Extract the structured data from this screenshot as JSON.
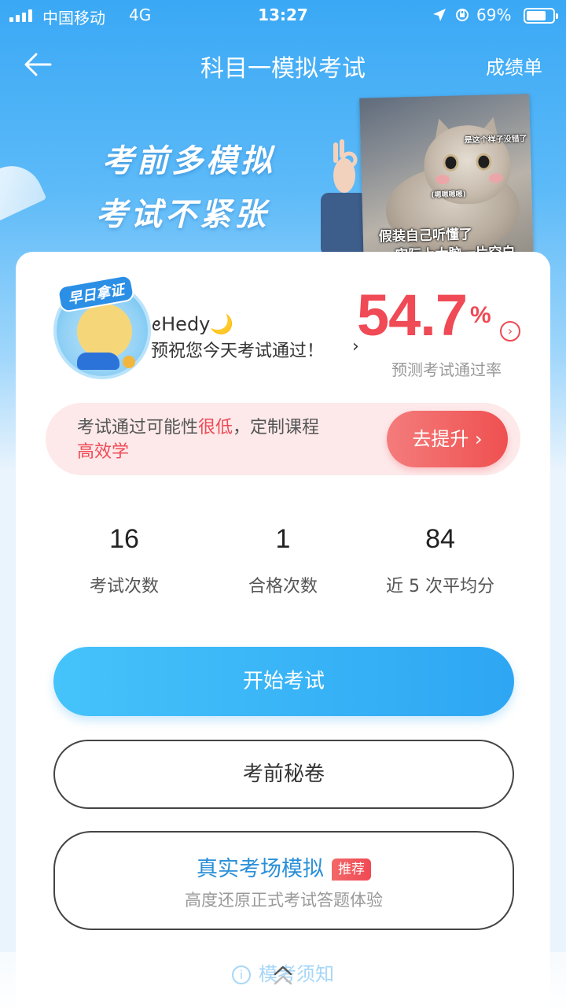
{
  "status_bar": {
    "carrier": "中国移动",
    "network": "4G",
    "time": "13:27",
    "battery_percent": "69%"
  },
  "nav": {
    "title": "科目一模拟考试",
    "right_link": "成绩单"
  },
  "banner": {
    "slogan_line1": "考前多模拟",
    "slogan_line2": "考试不紧张",
    "meme_small1": "是这个样子没错了",
    "meme_small2": "(嗯嗯嗯嗯)",
    "meme_line1": "假装自己听懂了",
    "meme_line2": "实际上大脑一片空白"
  },
  "profile": {
    "avatar_tag": "早日拿证",
    "username": "ꫀHedy",
    "username_emoji": "🌙",
    "wish": "预祝您今天考试通过！",
    "wish_arrow": "›"
  },
  "prediction": {
    "value": "54.7",
    "unit": "%",
    "label": "预测考试通过率"
  },
  "alert": {
    "text_before": "考试通过可能性",
    "text_red": "很低",
    "text_after": "，定制课程",
    "text_line2": "高效学",
    "button_label": "去提升 ›"
  },
  "stats": [
    {
      "value": "16",
      "label": "考试次数"
    },
    {
      "value": "1",
      "label": "合格次数"
    },
    {
      "value": "84",
      "label": "近 5 次平均分"
    }
  ],
  "actions": {
    "start_label": "开始考试",
    "secret_label": "考前秘卷",
    "real_title": "真实考场模拟",
    "real_badge": "推荐",
    "real_subtitle": "高度还原正式考试答题体验"
  },
  "footer": {
    "notice_label": "模考须知",
    "info_glyph": "i"
  },
  "colors": {
    "brand_blue": "#2ea6f3",
    "alert_red": "#ef4a55"
  }
}
